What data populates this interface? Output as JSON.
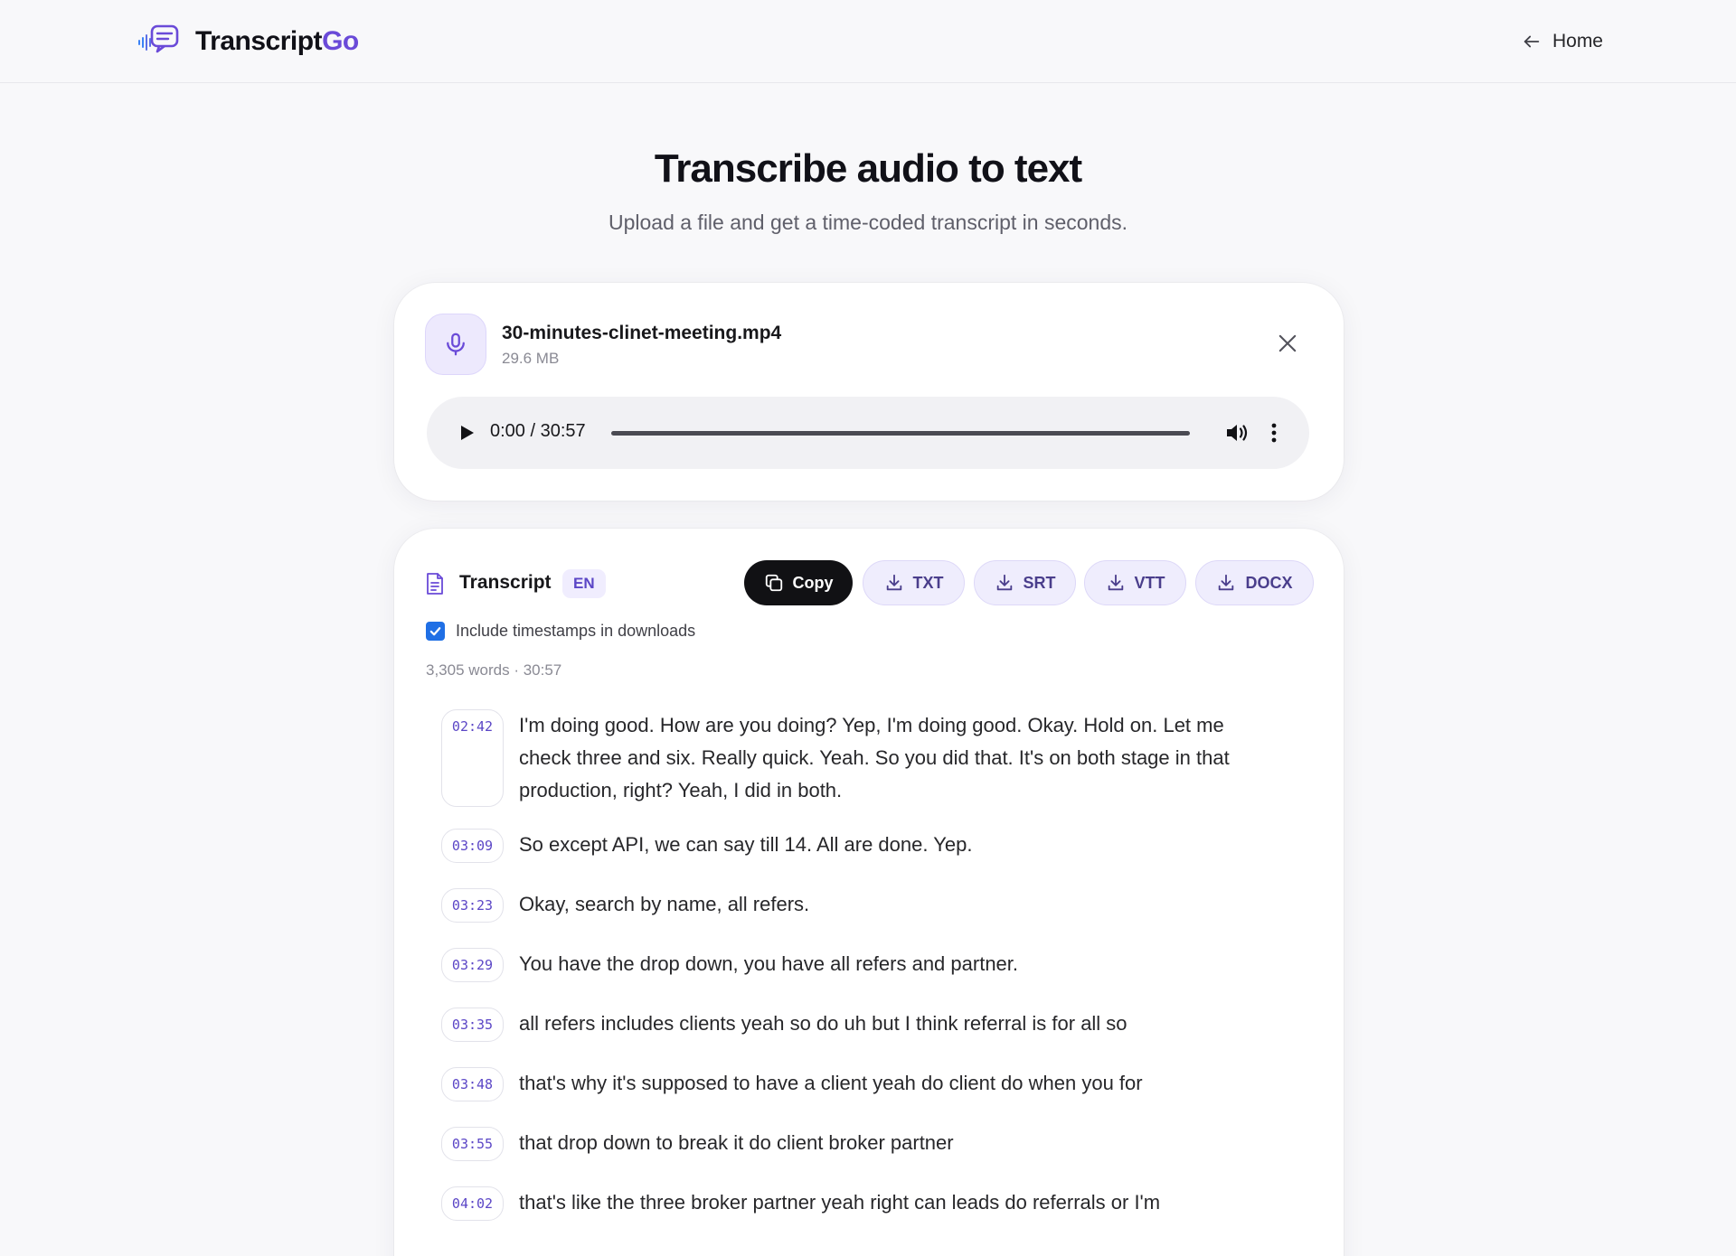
{
  "header": {
    "brand_main": "Transcript",
    "brand_accent": "Go",
    "home_label": "Home"
  },
  "hero": {
    "title": "Transcribe audio to text",
    "subtitle": "Upload a file and get a time-coded transcript in seconds."
  },
  "file": {
    "name": "30-minutes-clinet-meeting.mp4",
    "size": "29.6 MB",
    "player_time": "0:00 / 30:57",
    "progress": 0
  },
  "transcript": {
    "title": "Transcript",
    "language": "EN",
    "buttons": {
      "copy": "Copy",
      "txt": "TXT",
      "srt": "SRT",
      "vtt": "VTT",
      "docx": "DOCX"
    },
    "include_timestamps_label": "Include timestamps in downloads",
    "include_timestamps_checked": true,
    "stats": "3,305 words · 30:57",
    "segments": [
      {
        "time": "02:42",
        "text": "I'm doing good. How are you doing? Yep, I'm doing good. Okay. Hold on. Let me check three and six. Really quick. Yeah. So you did that. It's on both stage in that production, right? Yeah, I did in both."
      },
      {
        "time": "03:09",
        "text": "So except API, we can say till 14. All are done. Yep."
      },
      {
        "time": "03:23",
        "text": "Okay, search by name, all refers."
      },
      {
        "time": "03:29",
        "text": "You have the drop down, you have all refers and partner."
      },
      {
        "time": "03:35",
        "text": "all refers includes clients yeah so do uh but I think referral is for all so"
      },
      {
        "time": "03:48",
        "text": "that's why it's supposed to have a client yeah do client do when you for"
      },
      {
        "time": "03:55",
        "text": "that drop down to break it do client broker partner"
      },
      {
        "time": "04:02",
        "text": "that's like the three broker partner yeah right can leads do referrals or I'm"
      }
    ]
  },
  "colors": {
    "accent": "#6a4ad8",
    "copy_button_bg": "#111114",
    "checkbox": "#1f6fe5",
    "badge_bg": "#f0edfe"
  },
  "icons": {
    "logo": "chat-waveform-icon",
    "home": "arrow-left-icon",
    "file": "microphone-icon",
    "close": "close-icon",
    "play": "play-icon",
    "volume": "volume-icon",
    "more": "more-vertical-icon",
    "transcript": "document-icon",
    "copy": "copy-icon",
    "download": "download-icon",
    "check": "check-icon"
  }
}
